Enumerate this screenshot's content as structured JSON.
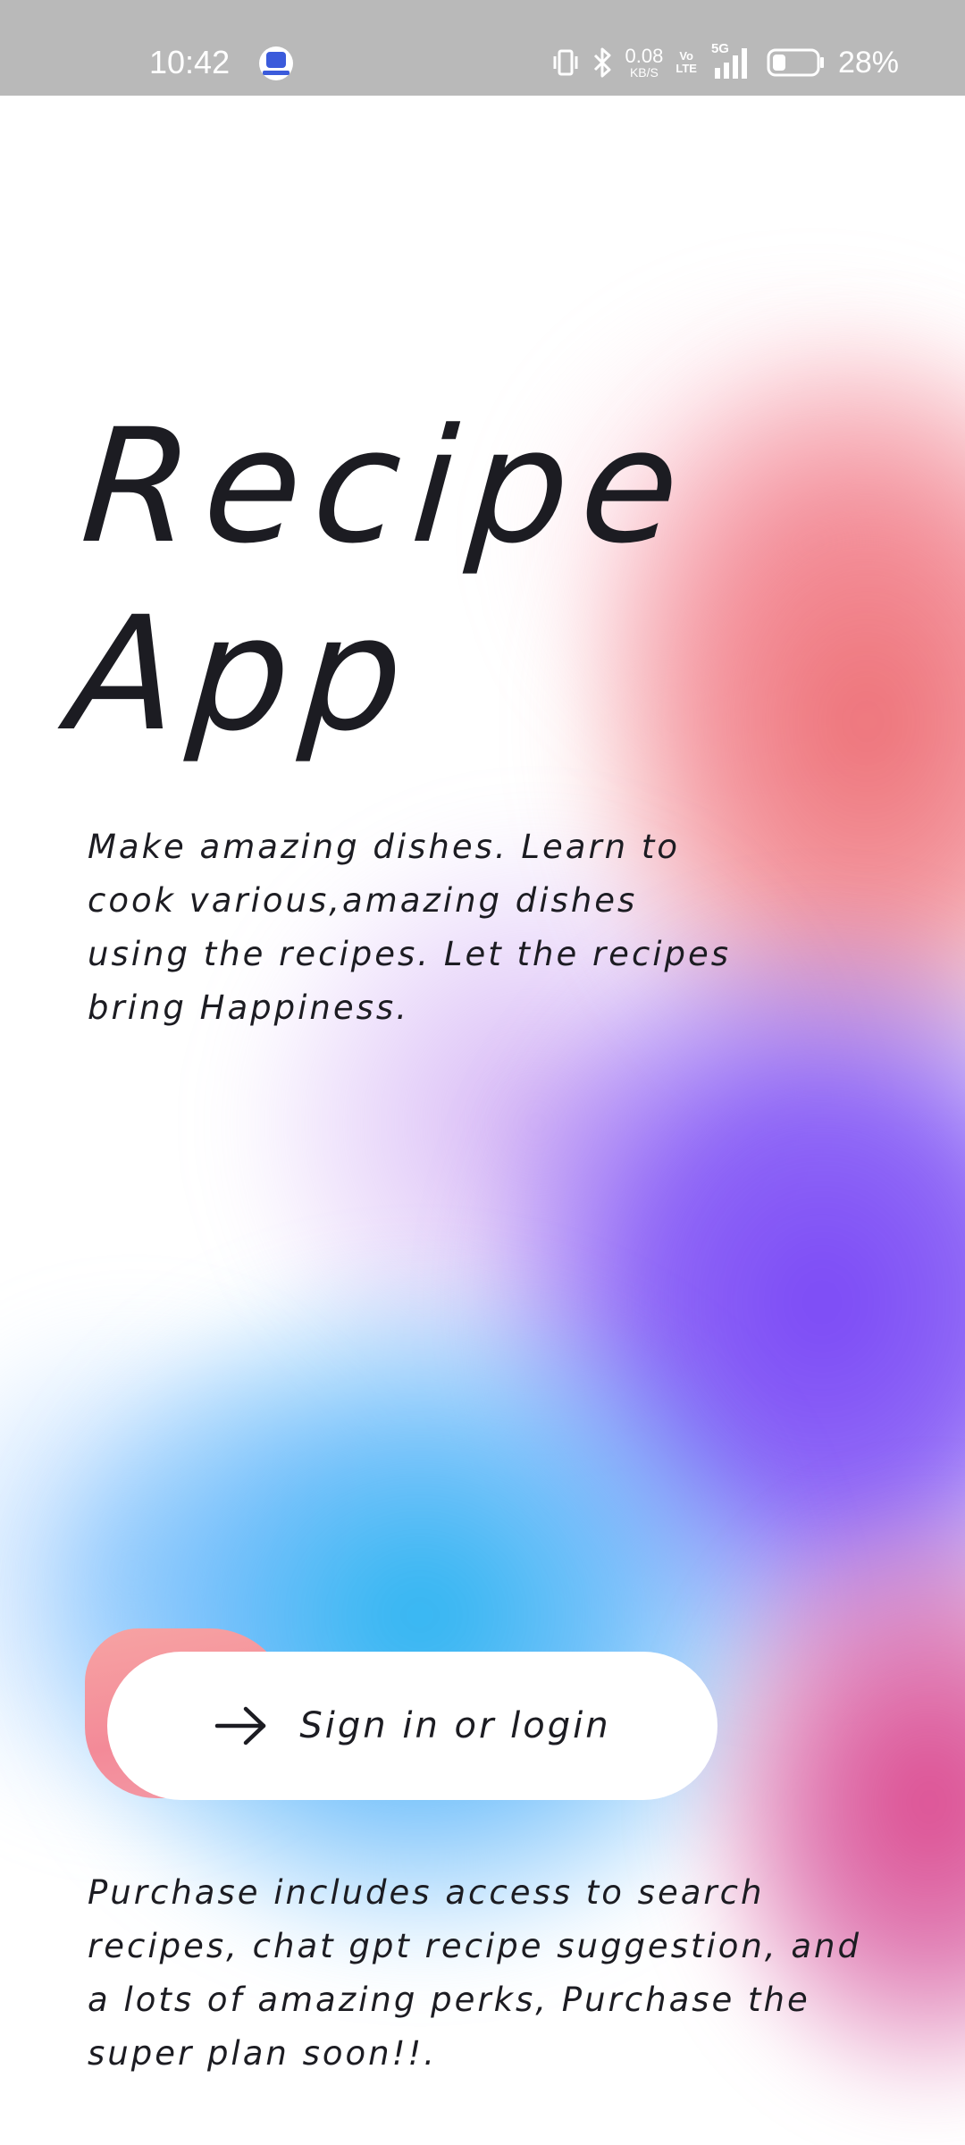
{
  "status_bar": {
    "time": "10:42",
    "app_icon": "app-notification-icon",
    "network_speed_value": "0.08",
    "network_speed_unit": "KB/S",
    "volte_line1": "Vo",
    "volte_line2": "LTE",
    "network_type": "5G",
    "battery_percent": "28%",
    "icons": [
      "vibrate-icon",
      "bluetooth-icon",
      "signal-icon",
      "battery-icon"
    ]
  },
  "hero": {
    "title_line1": "Recipe",
    "title_line2": "App",
    "description": "Make amazing dishes. Learn to cook various,amazing dishes using the recipes. Let the recipes bring Happiness."
  },
  "signin": {
    "label": "Sign in or login",
    "icon": "arrow-right-icon"
  },
  "footer": {
    "text": "Purchase includes access to search recipes, chat gpt recipe suggestion, and a lots of amazing perks, Purchase the super plan soon!!."
  },
  "colors": {
    "status_bar_bg": "#b9b9b9",
    "text": "#1c1c22",
    "gradient_red": "#ec686e",
    "gradient_purple": "#7a47f6",
    "gradient_blue": "#28b4f0",
    "gradient_magenta": "#dc468c",
    "button_accent": "#f38a98"
  }
}
